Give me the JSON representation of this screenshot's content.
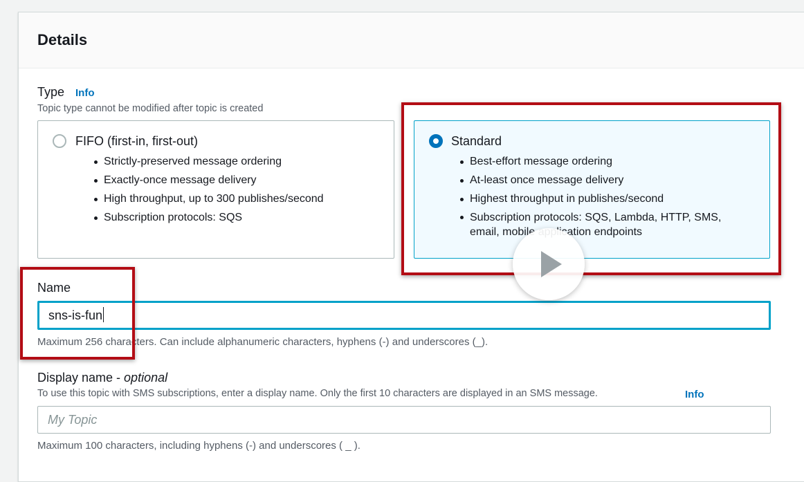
{
  "panel": {
    "title": "Details"
  },
  "type_section": {
    "label": "Type",
    "info_link": "Info",
    "description": "Topic type cannot be modified after topic is created",
    "options": [
      {
        "title": "FIFO (first-in, first-out)",
        "selected": false,
        "bullets": [
          "Strictly-preserved message ordering",
          "Exactly-once message delivery",
          "High throughput, up to 300 publishes/second",
          "Subscription protocols: SQS"
        ]
      },
      {
        "title": "Standard",
        "selected": true,
        "bullets": [
          "Best-effort message ordering",
          "At-least once message delivery",
          "Highest throughput in publishes/second",
          "Subscription protocols: SQS, Lambda, HTTP, SMS, email, mobile application endpoints"
        ]
      }
    ]
  },
  "name_field": {
    "label": "Name",
    "value": "sns-is-fun",
    "hint": "Maximum 256 characters. Can include alphanumeric characters, hyphens (-) and underscores (_)."
  },
  "display_name_field": {
    "label": "Display name - ",
    "label_optional": "optional",
    "description": "To use this topic with SMS subscriptions, enter a display name. Only the first 10 characters are displayed in an SMS message.",
    "info_link": "Info",
    "placeholder": "My Topic",
    "value": "",
    "hint": "Maximum 100 characters, including hyphens (-) and underscores ( _ )."
  },
  "colors": {
    "accent": "#0073bb",
    "selected_border": "#00a1c9",
    "highlight_box": "#b30d15"
  },
  "overlay": {
    "icon": "play-icon"
  }
}
